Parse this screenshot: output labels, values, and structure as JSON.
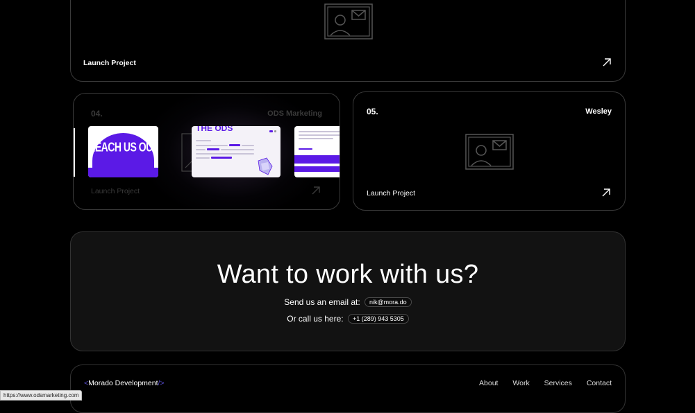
{
  "cards": {
    "top": {
      "launch": "Launch Project"
    },
    "card4": {
      "number": "04.",
      "client": "ODS Marketing",
      "launch": "Launch Project",
      "slide_title": "REACH US OUT"
    },
    "card5": {
      "number": "05.",
      "client": "Wesley",
      "launch": "Launch Project"
    }
  },
  "cta": {
    "title": "Want to work with us?",
    "email_label": "Send us an email at:",
    "email": "nik@mora.do",
    "phone_label": "Or call us here:",
    "phone": "+1 (289) 943 5305"
  },
  "footer": {
    "brand_open": "<",
    "brand": "Morado Development",
    "brand_close": "/>",
    "nav": [
      "About",
      "Work",
      "Services",
      "Contact"
    ]
  },
  "status_url": "https://www.odsmarketing.com",
  "colors": {
    "accent": "#5b1ae6",
    "background": "#000000",
    "panel": "#121212"
  }
}
